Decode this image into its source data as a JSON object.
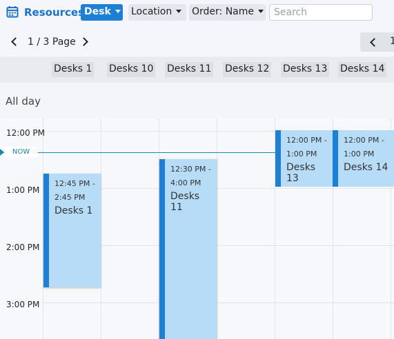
{
  "toolbar": {
    "title": "Resources",
    "resource_type": "Desk",
    "location_label": "Location",
    "order_label": "Order: Name",
    "search_placeholder": "Search"
  },
  "pager": {
    "page_label": "1 / 3 Page",
    "right_page_number": "1"
  },
  "resources": [
    "Desks 1",
    "Desks 10",
    "Desks 11",
    "Desks 12",
    "Desks 13",
    "Desks 14"
  ],
  "allday_label": "All day",
  "now_label": "NOW",
  "times": [
    "12:00 PM",
    "1:00 PM",
    "2:00 PM",
    "3:00 PM"
  ],
  "events": [
    {
      "start": "12:45 PM",
      "end": "2:45 PM",
      "title": "Desks 1"
    },
    {
      "start": "12:30 PM",
      "end": "4:00 PM",
      "title": "Desks 11"
    },
    {
      "start": "12:00 PM",
      "end": "1:00 PM",
      "title": "Desks 13"
    },
    {
      "start": "12:00 PM",
      "end": "1:00 PM",
      "title": "Desks 14"
    }
  ],
  "colors": {
    "accent": "#1e7fd6",
    "event_fill": "#b7dcf7",
    "now_line": "#1a8ab0"
  }
}
